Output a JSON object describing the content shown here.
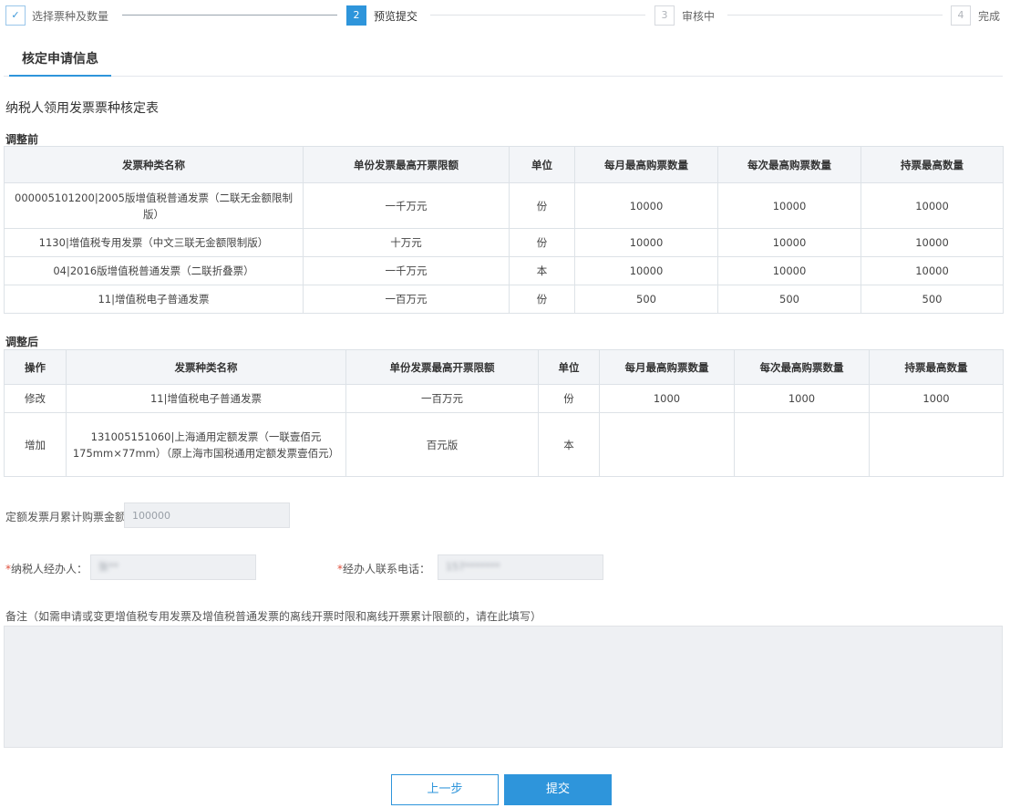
{
  "steps": [
    {
      "num": "✓",
      "label": "选择票种及数量"
    },
    {
      "num": "2",
      "label": "预览提交"
    },
    {
      "num": "3",
      "label": "审核中"
    },
    {
      "num": "4",
      "label": "完成"
    }
  ],
  "tab": {
    "label": "核定申请信息"
  },
  "form_title": "纳税人领用发票票种核定表",
  "before": {
    "title": "调整前",
    "headers": [
      "发票种类名称",
      "单份发票最高开票限额",
      "单位",
      "每月最高购票数量",
      "每次最高购票数量",
      "持票最高数量"
    ],
    "rows": [
      [
        "000005101200|2005版增值税普通发票（二联无金额限制版）",
        "一千万元",
        "份",
        "10000",
        "10000",
        "10000"
      ],
      [
        "1130|增值税专用发票（中文三联无金额限制版）",
        "十万元",
        "份",
        "10000",
        "10000",
        "10000"
      ],
      [
        "04|2016版增值税普通发票（二联折叠票）",
        "一千万元",
        "本",
        "10000",
        "10000",
        "10000"
      ],
      [
        "11|增值税电子普通发票",
        "一百万元",
        "份",
        "500",
        "500",
        "500"
      ]
    ]
  },
  "after": {
    "title": "调整后",
    "headers": [
      "操作",
      "发票种类名称",
      "单份发票最高开票限额",
      "单位",
      "每月最高购票数量",
      "每次最高购票数量",
      "持票最高数量"
    ],
    "rows": [
      [
        "修改",
        "11|增值税电子普通发票",
        "一百万元",
        "份",
        "1000",
        "1000",
        "1000"
      ],
      [
        "增加",
        "131005151060|上海通用定额发票（一联壹佰元175mm×77mm）（原上海市国税通用定额发票壹佰元）",
        "百元版",
        "本",
        "",
        "",
        ""
      ]
    ]
  },
  "fields": {
    "quota_label": "定额发票月累计购票金额：",
    "quota_value": "100000",
    "agent_label": "纳税人经办人：",
    "agent_value": "张**",
    "phone_label": "经办人联系电话：",
    "phone_value": "157*******",
    "required_mark": "*"
  },
  "remark": {
    "label": "备注（如需申请或变更增值税专用发票及增值税普通发票的离线开票时限和离线开票累计限额的，请在此填写）",
    "value": ""
  },
  "buttons": {
    "prev": "上一步",
    "submit": "提交"
  },
  "colors": {
    "accent": "#2e95db",
    "input_bg": "#eef0f3",
    "header_bg": "#f3f5f8",
    "required": "#e0503c"
  }
}
